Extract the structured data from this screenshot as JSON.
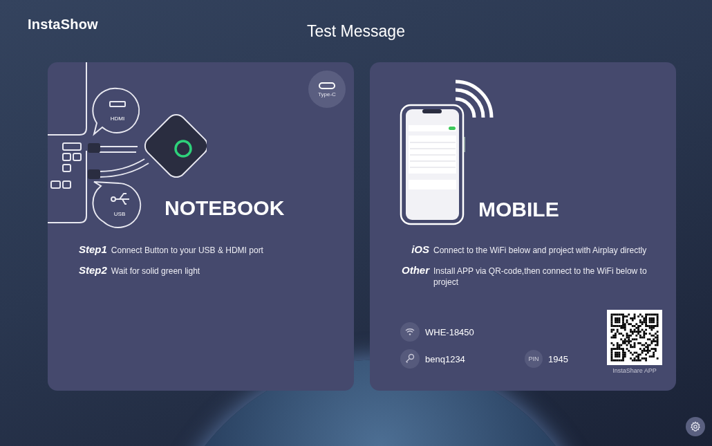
{
  "header": {
    "logo": "InstaShow",
    "title": "Test Message"
  },
  "notebook": {
    "badge": "Type-C",
    "hdmi_label": "HDMI",
    "usb_label": "USB",
    "heading": "NOTEBOOK",
    "steps": [
      {
        "label": "Step1",
        "text": "Connect Button to your USB & HDMI port"
      },
      {
        "label": "Step2",
        "text": "Wait for solid green light"
      }
    ]
  },
  "mobile": {
    "heading": "MOBILE",
    "instructions": [
      {
        "label": "iOS",
        "text": "Connect to the WiFi below and project with Airplay directly"
      },
      {
        "label": "Other",
        "text": "Install APP via QR-code,then connect to the WiFi below to project"
      }
    ],
    "wifi": {
      "ssid": "WHE-18450",
      "password": "benq1234",
      "pin_label": "PIN",
      "pin": "1945"
    },
    "qr_caption": "InstaShare APP"
  }
}
